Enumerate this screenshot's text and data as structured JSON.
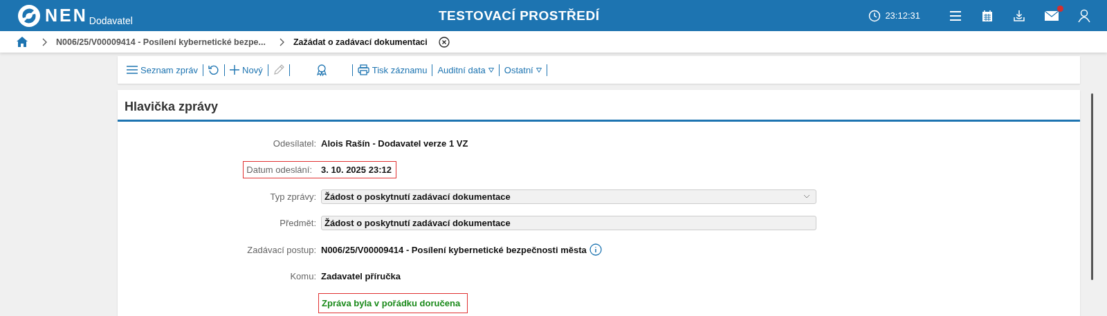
{
  "header": {
    "logo": "NEN",
    "subtitle": "Dodavatel",
    "title": "TESTOVACÍ PROSTŘEDÍ",
    "clock": "23:12:31",
    "mail_notification": true
  },
  "breadcrumb": [
    {
      "label": "N006/25/V00009414 - Posílení kybernetické bezpe...",
      "selected": false
    },
    {
      "label": "Zažádat o zadávací dokumentaci",
      "selected": true
    }
  ],
  "toolbar": [
    {
      "kind": "menu",
      "label": "Seznam zpráv",
      "disabled": false
    },
    {
      "kind": "refresh",
      "disabled": false
    },
    {
      "kind": "plus",
      "label": "Nový",
      "disabled": false
    },
    {
      "kind": "pencil",
      "disabled": true
    },
    {
      "kind": "award",
      "disabled": false
    },
    {
      "kind": "print",
      "label": "Tisk záznamu",
      "disabled": false
    },
    {
      "kind": "dropdown",
      "label": "Auditní data",
      "disabled": false
    },
    {
      "kind": "dropdown",
      "label": "Ostatní",
      "disabled": false
    }
  ],
  "section": {
    "title": "Hlavička zprávy",
    "fields": [
      {
        "label": "Odesílatel:",
        "kind": "text",
        "value": "Alois Rašín - Dodavatel verze 1 VZ",
        "highlighted": false
      },
      {
        "label": "Datum odeslání:",
        "kind": "text",
        "value": "3. 10. 2025 23:12",
        "highlighted": true
      },
      {
        "label": "Typ zprávy:",
        "kind": "select",
        "value": "Žádost o poskytnutí zadávací dokumentace",
        "highlighted": false
      },
      {
        "label": "Předmět:",
        "kind": "input",
        "value": "Žádost o poskytnutí zadávací dokumentace",
        "highlighted": false
      },
      {
        "label": "Zadávací postup:",
        "kind": "info",
        "value": "N006/25/V00009414 - Posílení kybernetické bezpečnosti města",
        "highlighted": false
      },
      {
        "label": "Komu:",
        "kind": "text",
        "value": "Zadavatel příručka",
        "highlighted": false
      }
    ],
    "status": {
      "text": "Zpráva byla v pořádku doručena",
      "highlighted": true
    }
  }
}
